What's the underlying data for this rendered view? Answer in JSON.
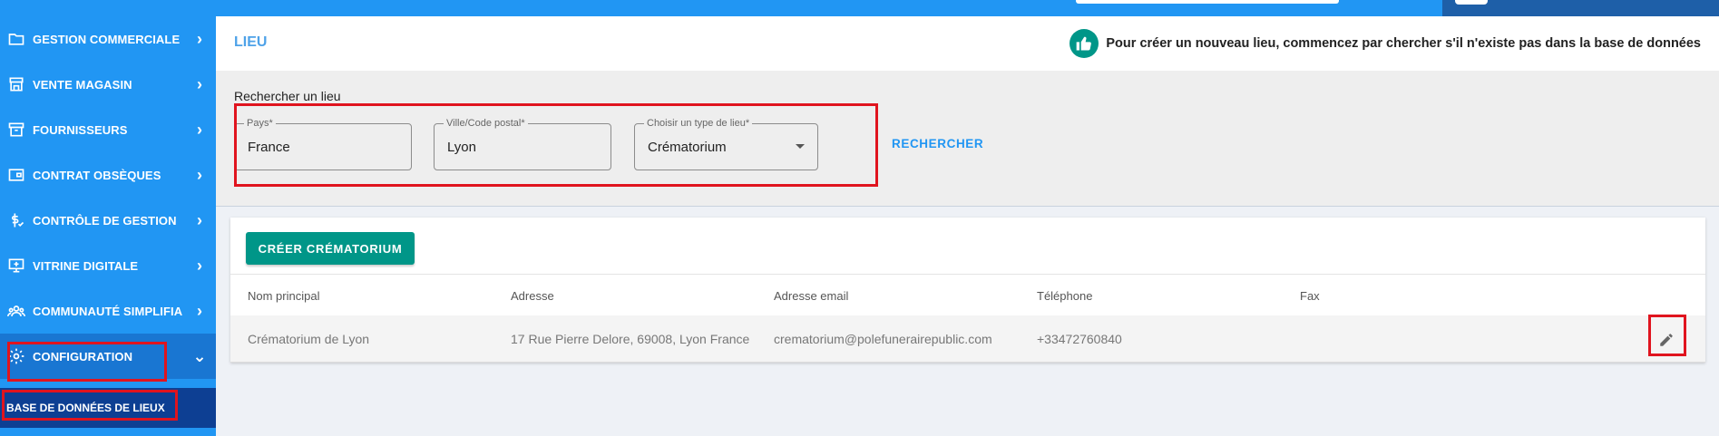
{
  "sidebar": {
    "items": [
      {
        "label": "GESTION COMMERCIALE",
        "icon": "folder-icon"
      },
      {
        "label": "VENTE MAGASIN",
        "icon": "store-icon"
      },
      {
        "label": "FOURNISSEURS",
        "icon": "archive-icon"
      },
      {
        "label": "CONTRAT OBSÈQUES",
        "icon": "contract-icon"
      },
      {
        "label": "CONTRÔLE DE GESTION",
        "icon": "money-icon"
      },
      {
        "label": "VITRINE DIGITALE",
        "icon": "monitor-icon"
      },
      {
        "label": "COMMUNAUTÉ SIMPLIFIA",
        "icon": "community-icon"
      },
      {
        "label": "CONFIGURATION",
        "icon": "settings-icon"
      }
    ],
    "sub_item": "BASE DE DONNÉES DE LIEUX"
  },
  "header": {
    "title": "LIEU",
    "tip": "Pour créer un nouveau lieu, commencez par chercher s'il n'existe pas dans la base de données"
  },
  "search": {
    "title": "Rechercher un lieu",
    "country_label": "Pays*",
    "country_value": "France",
    "city_label": "Ville/Code postal*",
    "city_value": "Lyon",
    "type_label": "Choisir un type de lieu*",
    "type_value": "Crématorium",
    "button": "RECHERCHER"
  },
  "table": {
    "create_button": "CRÉER CRÉMATORIUM",
    "columns": [
      "Nom principal",
      "Adresse",
      "Adresse email",
      "Téléphone",
      "Fax"
    ],
    "rows": [
      [
        "Crématorium de Lyon",
        "17 Rue Pierre Delore, 69008, Lyon France",
        "crematorium@polefunerairepublic.com",
        "+33472760840",
        ""
      ]
    ]
  },
  "colors": {
    "sidebar": "#2196f3",
    "active": "#1976d2",
    "sub_item": "#0d3f93",
    "accent_teal": "#009688",
    "highlight": "#e0141e"
  }
}
